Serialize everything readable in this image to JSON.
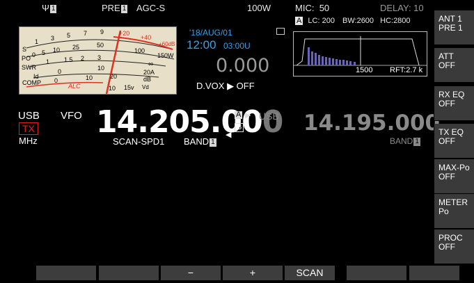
{
  "top_bar": {
    "ant_num": "1",
    "pre_label": "PRE",
    "pre_num": "1",
    "agc": "AGC-S",
    "power": "100W",
    "mic_label": "MIC:",
    "mic_value": "50",
    "delay": "DELAY: 10"
  },
  "meter": {
    "labels": [
      "S",
      "PO",
      "SWR",
      "Id",
      "COMP"
    ],
    "s_scale": [
      "1",
      "3",
      "5",
      "7",
      "9",
      "+20",
      "+40",
      "+60dB"
    ],
    "po_scale": [
      "0",
      "5",
      "10",
      "25",
      "50",
      "100",
      "150W"
    ],
    "swr_scale": [
      "1",
      "1.5",
      "2",
      "3",
      "∞"
    ],
    "id_scale": [
      "0",
      "10",
      "20A"
    ],
    "comp_scale": [
      "0",
      "10",
      "20",
      "dB"
    ],
    "alc_label": "ALC",
    "vd_scale": [
      "10",
      "15v",
      "Vd"
    ],
    "needle_value": "+20"
  },
  "clock": {
    "date": "'18/AUG/01",
    "time": "12:00",
    "utc": "03:00U"
  },
  "rit": "0.000",
  "dvox": "D.VOX ▶ OFF",
  "scope": {
    "vfo_tag": "A",
    "lc": "LC: 200",
    "bw": "BW:2600",
    "hc": "HC:2800",
    "freq_mark": "1500",
    "rft": "RFT:2.7 k"
  },
  "vfo_main": {
    "mode": "USB",
    "source": "VFO",
    "tx": "TX",
    "unit": "MHz",
    "freq_bright": "14.205.00",
    "freq_dim": "0",
    "scan": "SCAN-SPD1",
    "band_label": "BAND",
    "band_num": "1",
    "a_tag": "A",
    "b_tag": "B"
  },
  "vfo_sub": {
    "mode": "USB",
    "freq": "14.195.000",
    "band_label": "BAND",
    "band_num": "1"
  },
  "right_buttons": [
    {
      "line1": "ANT 1",
      "line2": "PRE 1"
    },
    {
      "line1": "ATT",
      "line2": "OFF"
    },
    {
      "line1": "RX EQ",
      "line2": "OFF"
    },
    {
      "line1": "TX EQ",
      "line2": "OFF"
    },
    {
      "line1": "MAX-Po",
      "line2": "OFF"
    },
    {
      "line1": "METER",
      "line2": "Po"
    },
    {
      "line1": "PROC",
      "line2": "OFF"
    }
  ],
  "bottom_buttons": [
    "",
    "",
    "−",
    "+",
    "SCAN",
    "",
    ""
  ],
  "colors": {
    "accent_blue": "#3aa0e6",
    "tx_red": "#e02020",
    "meter_bg": "#e7dfc7",
    "meter_red": "#e03020",
    "button_bg": "#3a3a3a"
  }
}
